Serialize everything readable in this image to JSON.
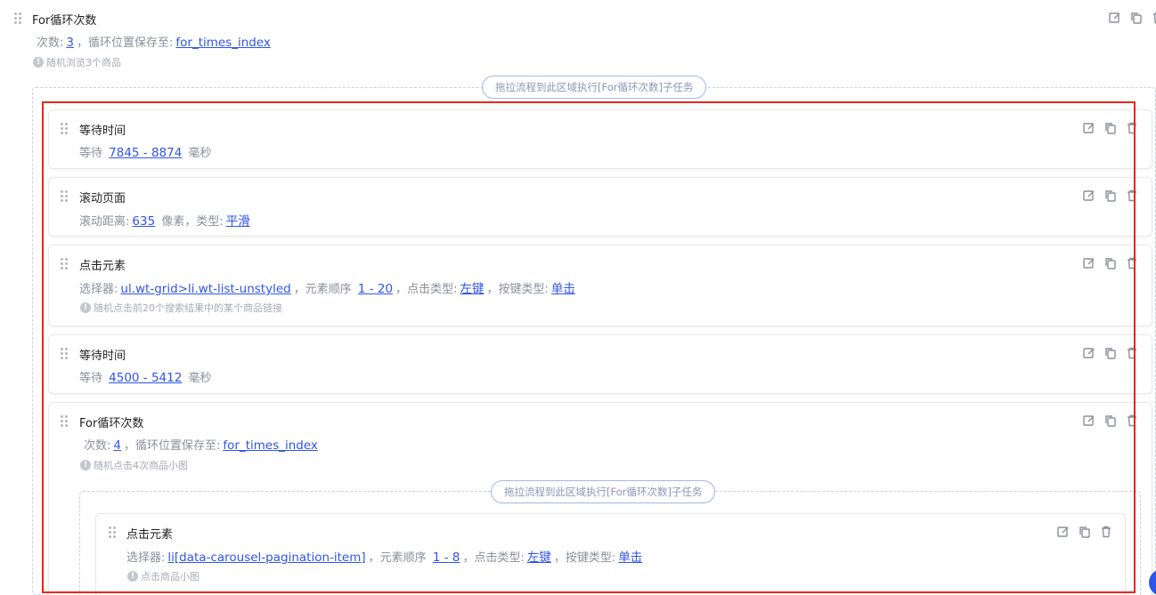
{
  "root": {
    "title": "For循环次数",
    "count_label": "次数:",
    "count_value": "3",
    "save_label": "，循环位置保存至:",
    "index_var": "for_times_index",
    "note": "随机浏览3个商品",
    "drop_hint": "拖拉流程到此区域执行[For循环次数]子任务"
  },
  "steps": [
    {
      "title": "等待时间",
      "prefix": "等待",
      "value": "7845 - 8874",
      "unit": "毫秒"
    },
    {
      "title": "滚动页面",
      "distance_label": "滚动距离:",
      "distance": "635",
      "unit_type": "像素，类型:",
      "type": "平滑"
    },
    {
      "title": "点击元素",
      "selector_label": "选择器:",
      "selector": "ul.wt-grid>li.wt-list-unstyled",
      "order_label": "，元素顺序",
      "order": "1 - 20",
      "click_label": "，点击类型:",
      "click": "左键",
      "key_label": "，按键类型:",
      "key": "单击",
      "note": "随机点击前20个搜索结果中的某个商品链接"
    },
    {
      "title": "等待时间",
      "prefix": "等待",
      "value": "4500 - 5412",
      "unit": "毫秒"
    },
    {
      "title": "For循环次数",
      "count_label": "次数:",
      "count_value": "4",
      "save_label": "，循环位置保存至:",
      "index_var": "for_times_index",
      "note": "随机点击4次商品小图",
      "drop_hint": "拖拉流程到此区域执行[For循环次数]子任务"
    },
    {
      "title": "点击元素",
      "selector_label": "选择器:",
      "selector": "li[data-carousel-pagination-item]",
      "order_label": "，元素顺序",
      "order": "1 - 8",
      "click_label": "，点击类型:",
      "click": "左键",
      "key_label": "，按键类型:",
      "key": "单击",
      "note": "点击商品小图"
    }
  ],
  "icons": {
    "edit": "edit-icon",
    "copy": "copy-icon",
    "delete": "delete-icon",
    "drag": "drag-handle-icon",
    "info": "info-icon"
  },
  "colors": {
    "link": "#2f54eb",
    "highlight_border": "#e8281c",
    "drop_zone": "#aab4e6"
  }
}
